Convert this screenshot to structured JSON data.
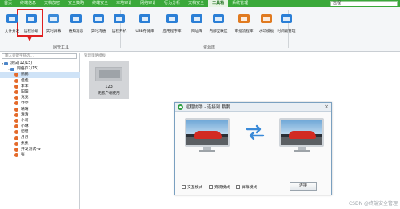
{
  "menu": {
    "tabs": [
      "首页",
      "终端信息",
      "文档加密",
      "安全策略",
      "终端安全",
      "本地审计",
      "网络审计",
      "行为分析",
      "文档安全",
      "工具箱",
      "系统管理"
    ],
    "active_index": 9,
    "search_value": "远程"
  },
  "ribbon": {
    "buttons": [
      {
        "label": "文件分发",
        "icon": "send-file-icon"
      },
      {
        "label": "远程协助",
        "icon": "remote-assist-icon"
      },
      {
        "label": "实时屏幕",
        "icon": "monitor-icon"
      },
      {
        "label": "通知消息",
        "icon": "message-icon"
      },
      {
        "label": "实时沟通",
        "icon": "chat-icon"
      },
      {
        "label": "远程开机",
        "icon": "power-on-icon"
      },
      {
        "label": "USB存储库",
        "icon": "usb-icon"
      },
      {
        "label": "应用程序库",
        "icon": "app-library-icon"
      },
      {
        "label": "网址库",
        "icon": "url-library-icon"
      },
      {
        "label": "内部互联区",
        "icon": "intranet-icon"
      },
      {
        "label": "审批流程库",
        "icon": "approval-icon"
      },
      {
        "label": "水印模板",
        "icon": "watermark-template-icon"
      },
      {
        "label": "时间段管理",
        "icon": "time-manage-icon"
      }
    ],
    "group_labels": [
      "网管工具",
      "资源库"
    ]
  },
  "tree": {
    "search_placeholder": "输入关键字筛选…",
    "nodes": [
      {
        "label": "测试(12/15)",
        "level": 0,
        "type": "group"
      },
      {
        "label": "网络(12/15)",
        "level": 1,
        "type": "group"
      },
      {
        "label": "鹏鹏",
        "level": 2,
        "type": "user",
        "selected": true
      },
      {
        "label": "佳佳",
        "level": 2,
        "type": "user"
      },
      {
        "label": "李李",
        "level": 2,
        "type": "user"
      },
      {
        "label": "阳阳",
        "level": 2,
        "type": "user"
      },
      {
        "label": "亮亮",
        "level": 2,
        "type": "user"
      },
      {
        "label": "乔乔",
        "level": 2,
        "type": "user"
      },
      {
        "label": "晴晴",
        "level": 2,
        "type": "user"
      },
      {
        "label": "清清",
        "level": 2,
        "type": "user"
      },
      {
        "label": "小哥",
        "level": 2,
        "type": "user"
      },
      {
        "label": "小琳",
        "level": 2,
        "type": "user"
      },
      {
        "label": "旭旭",
        "level": 2,
        "type": "user"
      },
      {
        "label": "月月",
        "level": 2,
        "type": "user"
      },
      {
        "label": "集集",
        "level": 2,
        "type": "user"
      },
      {
        "label": "开发测试-w",
        "level": 2,
        "type": "user"
      },
      {
        "label": "张",
        "level": 2,
        "type": "user"
      }
    ]
  },
  "content": {
    "breadcrumb": "管理策略模板",
    "template_card": {
      "number": "123",
      "name": "无客户端使用"
    }
  },
  "dialog": {
    "title": "远程协助 - 连接到 鹏鹏",
    "options": [
      "交互模式",
      "旁观模式",
      "屏幕模式"
    ],
    "connect_label": "连接"
  },
  "watermark": "CSDN @终端安全管理",
  "colors": {
    "menu_green": "#3aa83a",
    "highlight_red": "#e02020",
    "node_orange": "#e46a2a"
  }
}
